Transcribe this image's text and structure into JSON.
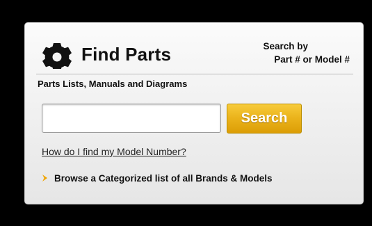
{
  "widget": {
    "title": "Find Parts",
    "icon": "gear-icon",
    "search_by_line1": "Search by",
    "search_by_line2": "Part # or Model #",
    "subtitle": "Parts Lists, Manuals and Diagrams"
  },
  "search": {
    "value": "",
    "placeholder": "",
    "button_label": "Search"
  },
  "links": {
    "help": "How do I find my Model Number?",
    "browse": "Browse a Categorized list of all Brands & Models"
  },
  "colors": {
    "page_background": "#000000",
    "button_gold": "#eab21a",
    "chevron_orange": "#f0a500",
    "text": "#111111"
  }
}
